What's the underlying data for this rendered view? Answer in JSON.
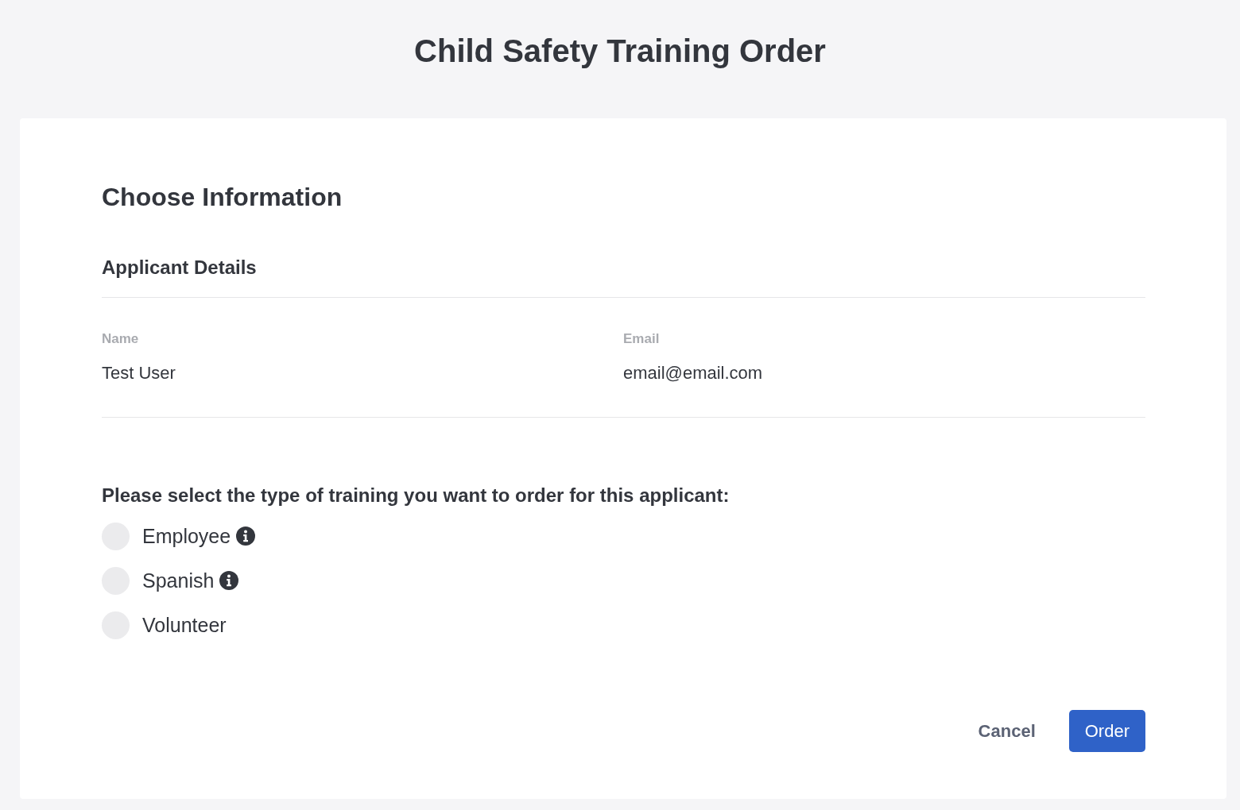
{
  "page": {
    "title": "Child Safety Training Order"
  },
  "form": {
    "heading": "Choose Information",
    "section": {
      "title": "Applicant Details",
      "fields": [
        {
          "label": "Name",
          "value": "Test User"
        },
        {
          "label": "Email",
          "value": "email@email.com"
        }
      ]
    },
    "question": "Please select the type of training you want to order for this applicant:",
    "options": [
      {
        "label": "Employee",
        "selected": false,
        "info": true
      },
      {
        "label": "Spanish",
        "selected": false,
        "info": true
      },
      {
        "label": "Volunteer",
        "selected": false,
        "info": false
      }
    ],
    "buttons": [
      {
        "kind": "secondary",
        "label": "Cancel"
      },
      {
        "kind": "primary",
        "label": "Order"
      }
    ]
  }
}
